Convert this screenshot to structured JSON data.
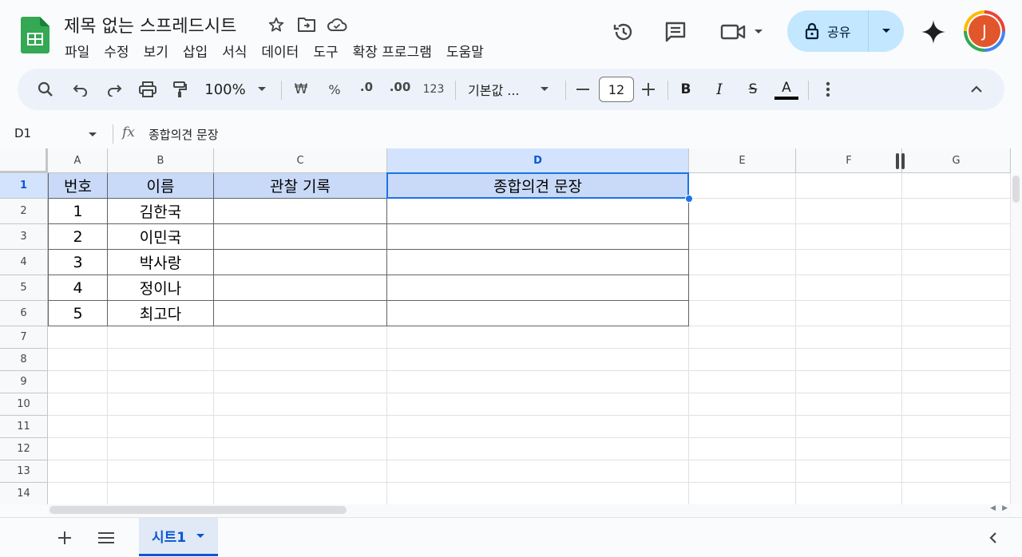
{
  "app": {
    "doc_title": "제목 없는 스프레드시트",
    "menu": [
      "파일",
      "수정",
      "보기",
      "삽입",
      "서식",
      "데이터",
      "도구",
      "확장 프로그램",
      "도움말"
    ],
    "share_label": "공유",
    "avatar_initial": "J"
  },
  "toolbar": {
    "zoom": "100%",
    "currency": "₩",
    "percent": "%",
    "dec_decrease": ".0",
    "dec_increase": ".00",
    "number_format": "123",
    "font_name": "기본값 ...",
    "font_size": "12",
    "bold": "B",
    "italic": "I",
    "strike": "S",
    "text_color": "A"
  },
  "formula_bar": {
    "cell_ref": "D1",
    "fx": "fx",
    "content": "종합의견 문장"
  },
  "grid": {
    "columns": [
      "A",
      "B",
      "C",
      "D",
      "E",
      "F",
      "G"
    ],
    "selected_column": "D",
    "rows": [
      "1",
      "2",
      "3",
      "4",
      "5",
      "6",
      "7",
      "8",
      "9",
      "10",
      "11",
      "12",
      "13",
      "14"
    ],
    "selected_row": "1",
    "header": [
      "번호",
      "이름",
      "관찰 기록",
      "종합의견 문장"
    ],
    "data": [
      [
        "1",
        "김한국",
        "",
        ""
      ],
      [
        "2",
        "이민국",
        "",
        ""
      ],
      [
        "3",
        "박사랑",
        "",
        ""
      ],
      [
        "4",
        "정이나",
        "",
        ""
      ],
      [
        "5",
        "최고다",
        "",
        ""
      ]
    ],
    "header_fill": "#c9daf8",
    "selection_color": "#1a73e8"
  },
  "sheets": {
    "tabs": [
      "시트1"
    ],
    "active": "시트1"
  }
}
